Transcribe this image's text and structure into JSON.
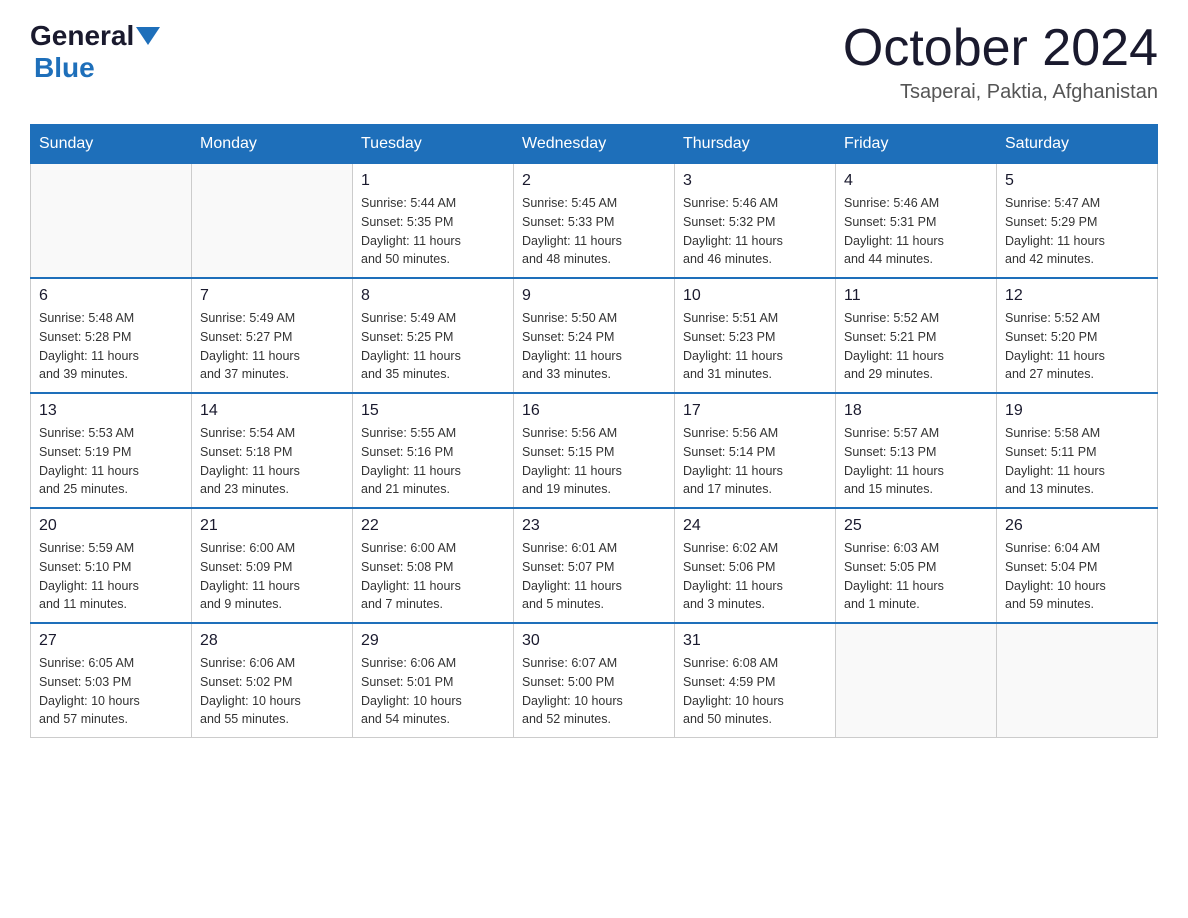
{
  "header": {
    "logo_general": "General",
    "logo_blue": "Blue",
    "month_title": "October 2024",
    "location": "Tsaperai, Paktia, Afghanistan"
  },
  "weekdays": [
    "Sunday",
    "Monday",
    "Tuesday",
    "Wednesday",
    "Thursday",
    "Friday",
    "Saturday"
  ],
  "weeks": [
    [
      {
        "day": "",
        "info": ""
      },
      {
        "day": "",
        "info": ""
      },
      {
        "day": "1",
        "info": "Sunrise: 5:44 AM\nSunset: 5:35 PM\nDaylight: 11 hours\nand 50 minutes."
      },
      {
        "day": "2",
        "info": "Sunrise: 5:45 AM\nSunset: 5:33 PM\nDaylight: 11 hours\nand 48 minutes."
      },
      {
        "day": "3",
        "info": "Sunrise: 5:46 AM\nSunset: 5:32 PM\nDaylight: 11 hours\nand 46 minutes."
      },
      {
        "day": "4",
        "info": "Sunrise: 5:46 AM\nSunset: 5:31 PM\nDaylight: 11 hours\nand 44 minutes."
      },
      {
        "day": "5",
        "info": "Sunrise: 5:47 AM\nSunset: 5:29 PM\nDaylight: 11 hours\nand 42 minutes."
      }
    ],
    [
      {
        "day": "6",
        "info": "Sunrise: 5:48 AM\nSunset: 5:28 PM\nDaylight: 11 hours\nand 39 minutes."
      },
      {
        "day": "7",
        "info": "Sunrise: 5:49 AM\nSunset: 5:27 PM\nDaylight: 11 hours\nand 37 minutes."
      },
      {
        "day": "8",
        "info": "Sunrise: 5:49 AM\nSunset: 5:25 PM\nDaylight: 11 hours\nand 35 minutes."
      },
      {
        "day": "9",
        "info": "Sunrise: 5:50 AM\nSunset: 5:24 PM\nDaylight: 11 hours\nand 33 minutes."
      },
      {
        "day": "10",
        "info": "Sunrise: 5:51 AM\nSunset: 5:23 PM\nDaylight: 11 hours\nand 31 minutes."
      },
      {
        "day": "11",
        "info": "Sunrise: 5:52 AM\nSunset: 5:21 PM\nDaylight: 11 hours\nand 29 minutes."
      },
      {
        "day": "12",
        "info": "Sunrise: 5:52 AM\nSunset: 5:20 PM\nDaylight: 11 hours\nand 27 minutes."
      }
    ],
    [
      {
        "day": "13",
        "info": "Sunrise: 5:53 AM\nSunset: 5:19 PM\nDaylight: 11 hours\nand 25 minutes."
      },
      {
        "day": "14",
        "info": "Sunrise: 5:54 AM\nSunset: 5:18 PM\nDaylight: 11 hours\nand 23 minutes."
      },
      {
        "day": "15",
        "info": "Sunrise: 5:55 AM\nSunset: 5:16 PM\nDaylight: 11 hours\nand 21 minutes."
      },
      {
        "day": "16",
        "info": "Sunrise: 5:56 AM\nSunset: 5:15 PM\nDaylight: 11 hours\nand 19 minutes."
      },
      {
        "day": "17",
        "info": "Sunrise: 5:56 AM\nSunset: 5:14 PM\nDaylight: 11 hours\nand 17 minutes."
      },
      {
        "day": "18",
        "info": "Sunrise: 5:57 AM\nSunset: 5:13 PM\nDaylight: 11 hours\nand 15 minutes."
      },
      {
        "day": "19",
        "info": "Sunrise: 5:58 AM\nSunset: 5:11 PM\nDaylight: 11 hours\nand 13 minutes."
      }
    ],
    [
      {
        "day": "20",
        "info": "Sunrise: 5:59 AM\nSunset: 5:10 PM\nDaylight: 11 hours\nand 11 minutes."
      },
      {
        "day": "21",
        "info": "Sunrise: 6:00 AM\nSunset: 5:09 PM\nDaylight: 11 hours\nand 9 minutes."
      },
      {
        "day": "22",
        "info": "Sunrise: 6:00 AM\nSunset: 5:08 PM\nDaylight: 11 hours\nand 7 minutes."
      },
      {
        "day": "23",
        "info": "Sunrise: 6:01 AM\nSunset: 5:07 PM\nDaylight: 11 hours\nand 5 minutes."
      },
      {
        "day": "24",
        "info": "Sunrise: 6:02 AM\nSunset: 5:06 PM\nDaylight: 11 hours\nand 3 minutes."
      },
      {
        "day": "25",
        "info": "Sunrise: 6:03 AM\nSunset: 5:05 PM\nDaylight: 11 hours\nand 1 minute."
      },
      {
        "day": "26",
        "info": "Sunrise: 6:04 AM\nSunset: 5:04 PM\nDaylight: 10 hours\nand 59 minutes."
      }
    ],
    [
      {
        "day": "27",
        "info": "Sunrise: 6:05 AM\nSunset: 5:03 PM\nDaylight: 10 hours\nand 57 minutes."
      },
      {
        "day": "28",
        "info": "Sunrise: 6:06 AM\nSunset: 5:02 PM\nDaylight: 10 hours\nand 55 minutes."
      },
      {
        "day": "29",
        "info": "Sunrise: 6:06 AM\nSunset: 5:01 PM\nDaylight: 10 hours\nand 54 minutes."
      },
      {
        "day": "30",
        "info": "Sunrise: 6:07 AM\nSunset: 5:00 PM\nDaylight: 10 hours\nand 52 minutes."
      },
      {
        "day": "31",
        "info": "Sunrise: 6:08 AM\nSunset: 4:59 PM\nDaylight: 10 hours\nand 50 minutes."
      },
      {
        "day": "",
        "info": ""
      },
      {
        "day": "",
        "info": ""
      }
    ]
  ]
}
